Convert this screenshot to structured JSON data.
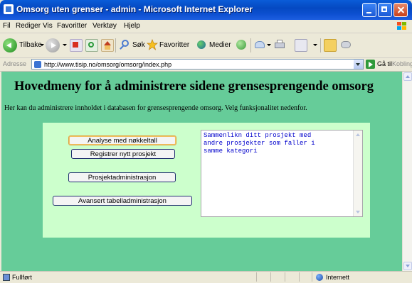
{
  "window": {
    "title": "Omsorg uten grenser - admin - Microsoft Internet Explorer"
  },
  "menu": [
    "Fil",
    "Rediger",
    "Vis",
    "Favoritter",
    "Verktøy",
    "Hjelp"
  ],
  "toolbar": {
    "back_label": "Tilbake",
    "search_label": "Søk",
    "favorites_label": "Favoritter",
    "media_label": "Medier"
  },
  "address": {
    "label": "Adresse",
    "url": "http://www.tisip.no/omsorg/omsorg/index.php",
    "go_label": "Gå til",
    "links_label": "Koblinger"
  },
  "page": {
    "heading": "Hovedmeny for å administrere sidene grensesprengende omsorg",
    "intro": "Her kan du administrere innholdet i databasen for grensesprengende omsorg. Velg funksjonalitet nedenfor.",
    "buttons": {
      "analyse": "Analyse med nøkkeltall",
      "register": "Registrer nytt prosjekt",
      "project_admin": "Prosjektadministrasjon",
      "table_admin": "Avansert tabelladministrasjon"
    },
    "description": "Sammenlikn ditt prosjekt med\nandre prosjekter som faller i\nsamme kategori"
  },
  "status": {
    "text": "Fullført",
    "zone": "Internett"
  },
  "colors": {
    "page_background": "#66cc99",
    "panel_background": "#ccffcc",
    "description_text": "#0000cc"
  }
}
